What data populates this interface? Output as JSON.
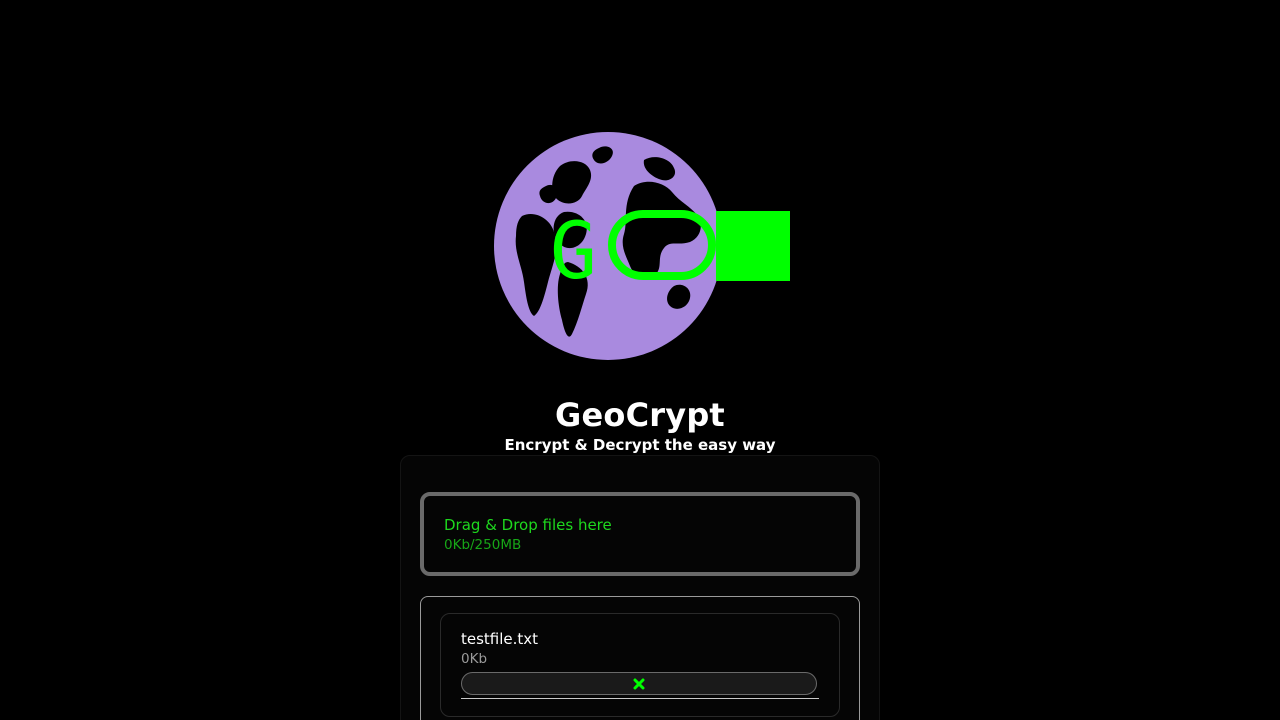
{
  "app": {
    "title": "GeoCrypt",
    "subtitle": "Encrypt & Decrypt the easy way",
    "logo_alt": "GeoCrypt globe logo",
    "logo_text": "GC"
  },
  "dropzone": {
    "label": "Drag & Drop files here",
    "usage": "0Kb/250MB"
  },
  "files": [
    {
      "name": "testfile.txt",
      "size": "0Kb",
      "action_icon": "remove-x-icon"
    }
  ],
  "colors": {
    "background": "#000000",
    "accent_green": "#00ff00",
    "globe_purple": "#a98adf",
    "text": "#ffffff",
    "muted": "#9a9a9a"
  }
}
